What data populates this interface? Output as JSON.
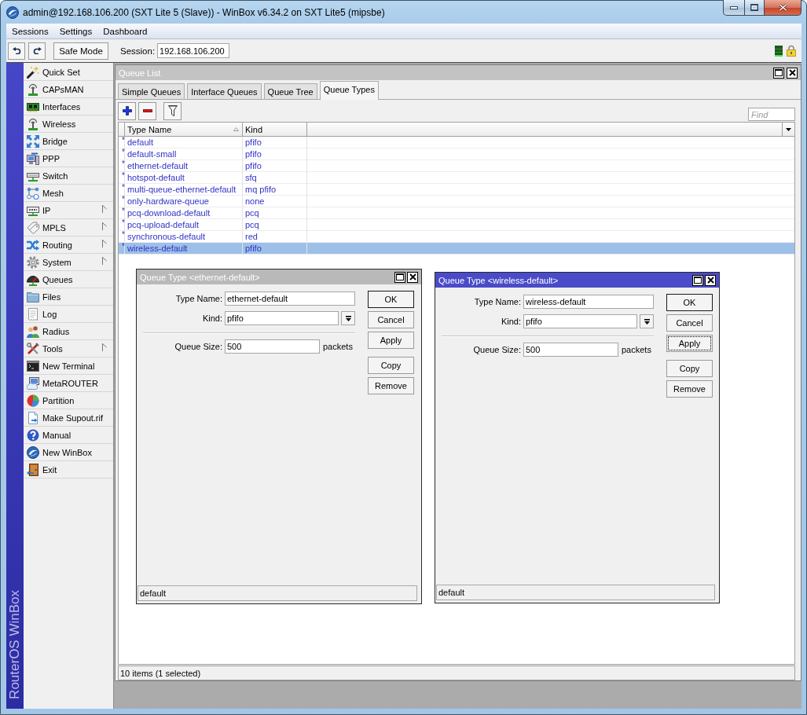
{
  "window": {
    "title": "admin@192.168.106.200 (SXT Lite 5 (Slave)) - WinBox v6.34.2 on SXT Lite5 (mipsbe)"
  },
  "menu_bar": [
    "Sessions",
    "Settings",
    "Dashboard"
  ],
  "toolbar": {
    "safe_mode": "Safe Mode",
    "session": {
      "label": "Session:",
      "value": "192.168.106.200"
    }
  },
  "sidebar": {
    "brand": "RouterOS WinBox",
    "items": [
      {
        "label": "Quick Set",
        "submenu": false
      },
      {
        "label": "CAPsMAN",
        "submenu": false
      },
      {
        "label": "Interfaces",
        "submenu": false
      },
      {
        "label": "Wireless",
        "submenu": false
      },
      {
        "label": "Bridge",
        "submenu": false
      },
      {
        "label": "PPP",
        "submenu": false
      },
      {
        "label": "Switch",
        "submenu": false
      },
      {
        "label": "Mesh",
        "submenu": false
      },
      {
        "label": "IP",
        "submenu": true
      },
      {
        "label": "MPLS",
        "submenu": true
      },
      {
        "label": "Routing",
        "submenu": true
      },
      {
        "label": "System",
        "submenu": true
      },
      {
        "label": "Queues",
        "submenu": false
      },
      {
        "label": "Files",
        "submenu": false
      },
      {
        "label": "Log",
        "submenu": false
      },
      {
        "label": "Radius",
        "submenu": false
      },
      {
        "label": "Tools",
        "submenu": true
      },
      {
        "label": "New Terminal",
        "submenu": false
      },
      {
        "label": "MetaROUTER",
        "submenu": false
      },
      {
        "label": "Partition",
        "submenu": false
      },
      {
        "label": "Make Supout.rif",
        "submenu": false
      },
      {
        "label": "Manual",
        "submenu": false
      },
      {
        "label": "New WinBox",
        "submenu": false
      },
      {
        "label": "Exit",
        "submenu": false
      }
    ]
  },
  "queue_list": {
    "title": "Queue List",
    "active": false,
    "tabs": [
      {
        "label": "Simple Queues",
        "selected": false
      },
      {
        "label": "Interface Queues",
        "selected": false
      },
      {
        "label": "Queue Tree",
        "selected": false
      },
      {
        "label": "Queue Types",
        "selected": true
      }
    ],
    "search": {
      "placeholder": "Find"
    },
    "table": {
      "columns": [
        {
          "label": "Type Name",
          "sorted": true
        },
        {
          "label": "Kind",
          "sorted": false
        }
      ],
      "rows": [
        {
          "flag": "*",
          "cells": [
            "default",
            "pfifo"
          ],
          "selected": false
        },
        {
          "flag": "*",
          "cells": [
            "default-small",
            "pfifo"
          ],
          "selected": false
        },
        {
          "flag": "*",
          "cells": [
            "ethernet-default",
            "pfifo"
          ],
          "selected": false
        },
        {
          "flag": "*",
          "cells": [
            "hotspot-default",
            "sfq"
          ],
          "selected": false
        },
        {
          "flag": "*",
          "cells": [
            "multi-queue-ethernet-default",
            "mq pfifo"
          ],
          "selected": false
        },
        {
          "flag": "*",
          "cells": [
            "only-hardware-queue",
            "none"
          ],
          "selected": false
        },
        {
          "flag": "*",
          "cells": [
            "pcq-download-default",
            "pcq"
          ],
          "selected": false
        },
        {
          "flag": "*",
          "cells": [
            "pcq-upload-default",
            "pcq"
          ],
          "selected": false
        },
        {
          "flag": "*",
          "cells": [
            "synchronous-default",
            "red"
          ],
          "selected": false
        },
        {
          "flag": "*",
          "cells": [
            "wireless-default",
            "pfifo"
          ],
          "selected": true
        }
      ]
    },
    "status_bar": "10 items (1 selected)"
  },
  "dialogs": [
    {
      "title": "Queue Type <ethernet-default>",
      "active": false,
      "fields": [
        {
          "kind": "text",
          "label": "Type Name:",
          "value": "ethernet-default"
        },
        {
          "kind": "dropdown",
          "label": "Kind:",
          "value": "pfifo"
        },
        {
          "kind": "separator"
        },
        {
          "kind": "text",
          "label": "Queue Size:",
          "value": "500",
          "unit": "packets"
        }
      ],
      "button_groups": [
        {
          "buttons": [
            {
              "label": "OK",
              "default": true,
              "focused": false
            },
            {
              "label": "Cancel",
              "default": false,
              "focused": false
            },
            {
              "label": "Apply",
              "default": false,
              "focused": false
            }
          ]
        },
        {
          "buttons": [
            {
              "label": "Copy",
              "default": false,
              "focused": false
            },
            {
              "label": "Remove",
              "default": false,
              "focused": false
            }
          ]
        }
      ],
      "status_bar": "default"
    },
    {
      "title": "Queue Type <wireless-default>",
      "active": true,
      "fields": [
        {
          "kind": "text",
          "label": "Type Name:",
          "value": "wireless-default"
        },
        {
          "kind": "dropdown",
          "label": "Kind:",
          "value": "pfifo"
        },
        {
          "kind": "separator"
        },
        {
          "kind": "text",
          "label": "Queue Size:",
          "value": "500",
          "unit": "packets"
        }
      ],
      "button_groups": [
        {
          "buttons": [
            {
              "label": "OK",
              "default": true,
              "focused": false
            },
            {
              "label": "Cancel",
              "default": false,
              "focused": false
            },
            {
              "label": "Apply",
              "default": false,
              "focused": true
            }
          ]
        },
        {
          "buttons": [
            {
              "label": "Copy",
              "default": false,
              "focused": false
            },
            {
              "label": "Remove",
              "default": false,
              "focused": false
            }
          ]
        }
      ],
      "status_bar": "default"
    }
  ]
}
